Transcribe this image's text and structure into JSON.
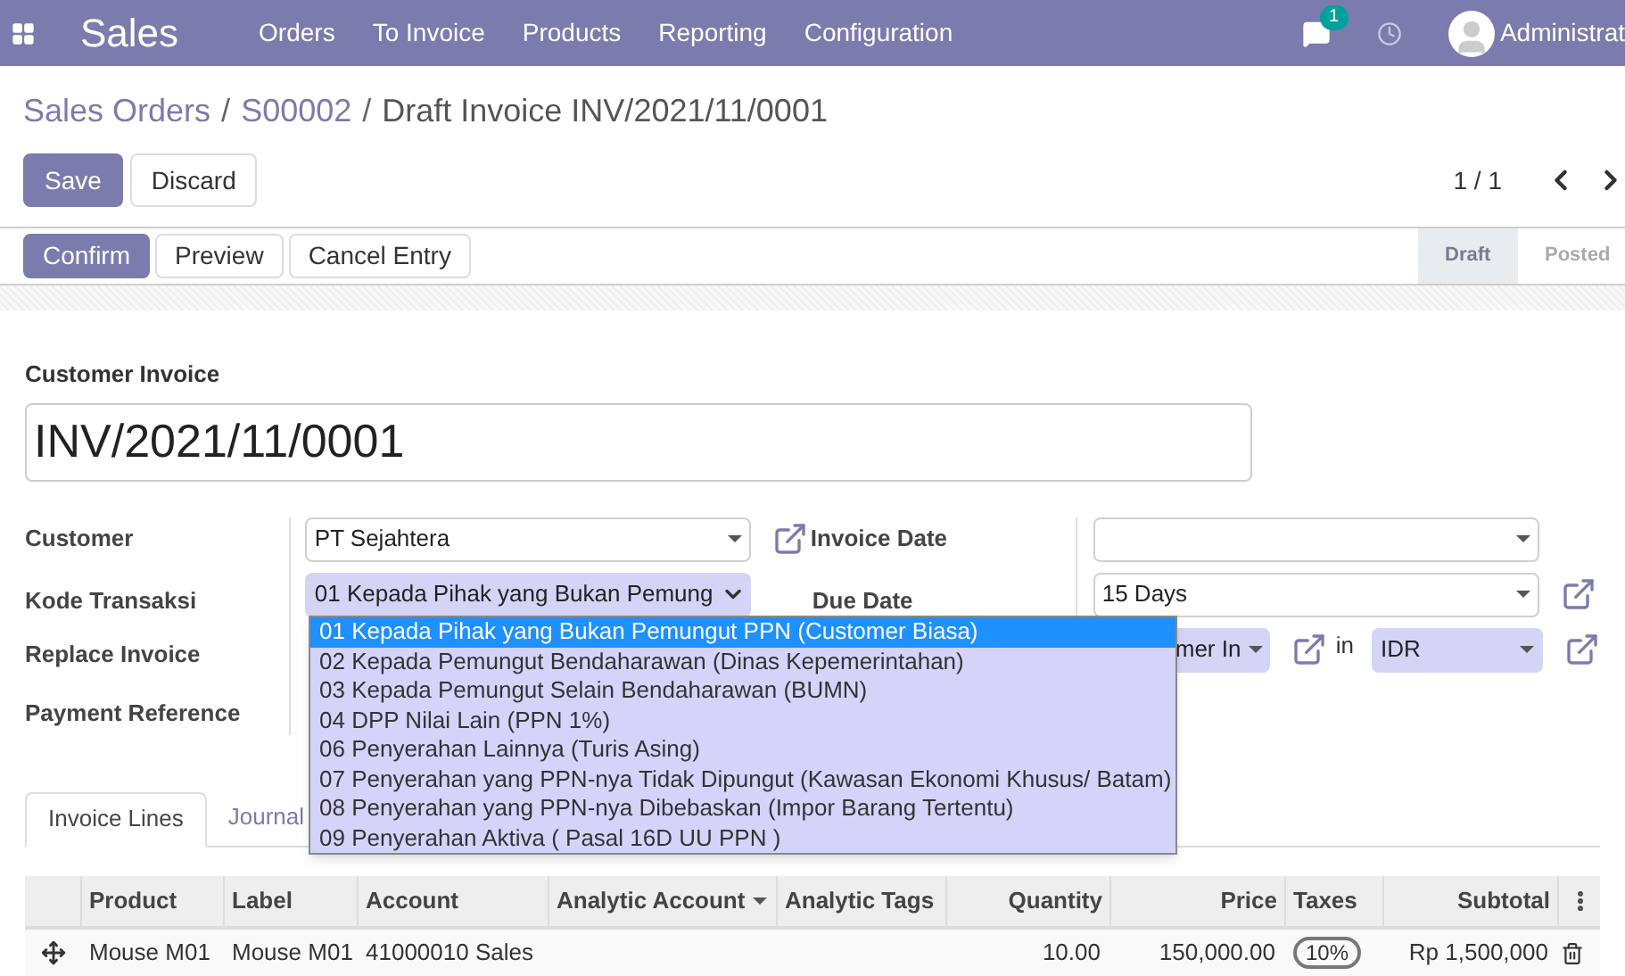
{
  "navbar": {
    "app": "Sales",
    "menu": [
      "Orders",
      "To Invoice",
      "Products",
      "Reporting",
      "Configuration"
    ],
    "message_count": "1",
    "user": "Administrat"
  },
  "breadcrumb": [
    {
      "label": "Sales Orders",
      "link": true
    },
    {
      "separator": "/",
      "label": "S00002",
      "link": true
    },
    {
      "separator": "/",
      "label": "Draft Invoice INV/2021/11/0001",
      "link": false
    }
  ],
  "buttons": [
    {
      "label": "Save",
      "primary": true
    },
    {
      "label": "Discard",
      "primary": false
    }
  ],
  "pager": "1 / 1",
  "actions": [
    {
      "label": "Confirm",
      "primary": true
    },
    {
      "label": "Preview",
      "primary": false
    },
    {
      "label": "Cancel Entry",
      "primary": false
    }
  ],
  "stages": [
    {
      "label": "Draft",
      "selected": true
    },
    {
      "label": "Posted",
      "selected": false
    }
  ],
  "form": {
    "type_label": "Customer Invoice",
    "number": "INV/2021/11/0001",
    "left_fields": [
      {
        "label": "Customer",
        "value": "PT Sejahtera",
        "kind": "select"
      },
      {
        "label": "Kode Transaksi",
        "value": "01 Kepada Pihak yang Bukan Pemung",
        "kind": "selection"
      },
      {
        "label": "Replace Invoice",
        "kind": "none"
      },
      {
        "label": "Payment Reference",
        "kind": "none"
      }
    ],
    "invoice_date": {
      "label": "Invoice Date"
    },
    "due_date": {
      "label": "Due Date",
      "value": "15 Days"
    },
    "journal": {
      "value": "mer In",
      "connector": "in",
      "currency": "IDR"
    }
  },
  "dropdown": [
    {
      "label": "01 Kepada Pihak yang Bukan Pemungut PPN (Customer Biasa)",
      "selected": true
    },
    {
      "label": "02 Kepada Pemungut Bendaharawan (Dinas Kepemerintahan)",
      "selected": false
    },
    {
      "label": "03 Kepada Pemungut Selain Bendaharawan (BUMN)",
      "selected": false
    },
    {
      "label": "04 DPP Nilai Lain (PPN 1%)",
      "selected": false
    },
    {
      "label": "06 Penyerahan Lainnya (Turis Asing)",
      "selected": false
    },
    {
      "label": "07 Penyerahan yang PPN-nya Tidak Dipungut (Kawasan Ekonomi Khusus/ Batam)",
      "selected": false
    },
    {
      "label": "08 Penyerahan yang PPN-nya Dibebaskan (Impor Barang Tertentu)",
      "selected": false
    },
    {
      "label": "09 Penyerahan Aktiva ( Pasal 16D UU PPN )",
      "selected": false
    }
  ],
  "tabs": [
    {
      "label": "Invoice Lines",
      "selected": true
    },
    {
      "label": "Journal",
      "selected": false
    }
  ],
  "table": {
    "columns": [
      "Product",
      "Label",
      "Account",
      "Analytic Account",
      "Analytic Tags",
      "Quantity",
      "Price",
      "Taxes",
      "Subtotal"
    ],
    "rows": [
      {
        "product": "Mouse M01",
        "label": "Mouse M01",
        "account": "41000010 Sales",
        "quantity": "10.00",
        "price": "150,000.00",
        "tax": "10%",
        "subtotal": "Rp 1,500,000"
      }
    ]
  }
}
